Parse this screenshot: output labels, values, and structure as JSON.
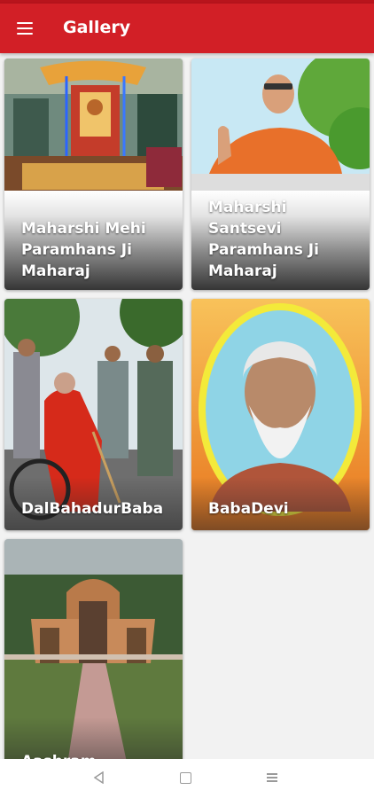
{
  "appbar": {
    "title": "Gallery",
    "menu_icon": "hamburger-menu-icon"
  },
  "gallery": {
    "items": [
      {
        "label": "Maharshi Mehi Paramhans Ji Maharaj",
        "lines": [
          "Maharshi Mehi",
          "Paramhans Ji",
          "Maharaj"
        ]
      },
      {
        "label": "Maharshi Santsevi Paramhans Ji Maharaj",
        "lines": [
          "Maharshi",
          "Santsevi",
          "Paramhans  Ji",
          "Maharaj"
        ]
      },
      {
        "label": "DalBahadurBaba"
      },
      {
        "label": "BabaDevi"
      },
      {
        "label": "Aashram"
      }
    ]
  },
  "navbar": {
    "back_icon": "back-triangle-icon",
    "home_icon": "home-square-icon",
    "recents_icon": "recents-lines-icon"
  },
  "colors": {
    "appbar": "#d21f26",
    "statusbar": "#b8141c",
    "background": "#f2f2f2"
  }
}
